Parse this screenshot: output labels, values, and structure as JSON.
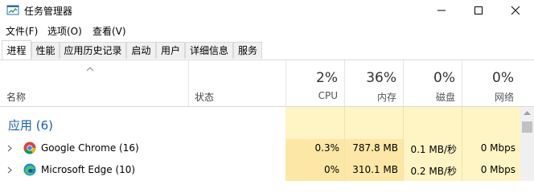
{
  "window": {
    "title": "任务管理器"
  },
  "menu": [
    "文件(F)",
    "选项(O)",
    "查看(V)"
  ],
  "tabs": [
    "进程",
    "性能",
    "应用历史记录",
    "启动",
    "用户",
    "详细信息",
    "服务"
  ],
  "header": {
    "name": "名称",
    "status": "状态",
    "columns": [
      {
        "percent": "2%",
        "label": "CPU"
      },
      {
        "percent": "36%",
        "label": "内存"
      },
      {
        "percent": "0%",
        "label": "磁盘"
      },
      {
        "percent": "0%",
        "label": "网络"
      }
    ]
  },
  "group": {
    "label": "应用 (6)"
  },
  "processes": [
    {
      "name": "Google Chrome (16)",
      "icon": "chrome-icon",
      "cpu": "0.3%",
      "memory": "787.8 MB",
      "disk": "0.1 MB/秒",
      "network": "0 Mbps"
    },
    {
      "name": "Microsoft Edge (10)",
      "icon": "edge-icon",
      "cpu": "0%",
      "memory": "310.1 MB",
      "disk": "0.2 MB/秒",
      "network": "0 Mbps"
    }
  ],
  "colors": {
    "highlight_light": "#fff4c4",
    "highlight_mid": "#fde7a6",
    "group_blue": "#1a5fb4"
  }
}
